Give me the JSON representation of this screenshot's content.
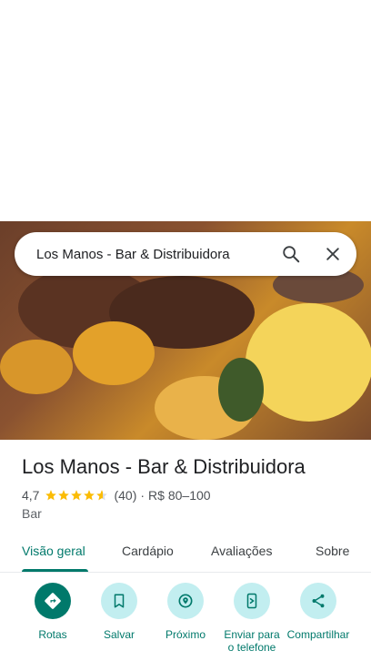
{
  "search": {
    "query": "Los Manos - Bar & Distribuidora"
  },
  "place": {
    "name": "Los Manos - Bar & Distribuidora",
    "rating": "4,7",
    "rating_value": 4.7,
    "review_count": "(40)",
    "separator": "·",
    "price_range": "R$ 80–100",
    "category": "Bar"
  },
  "tabs": [
    {
      "label": "Visão geral"
    },
    {
      "label": "Cardápio"
    },
    {
      "label": "Avaliações"
    },
    {
      "label": "Sobre"
    }
  ],
  "actions": [
    {
      "label": "Rotas",
      "icon": "directions-icon"
    },
    {
      "label": "Salvar",
      "icon": "bookmark-icon"
    },
    {
      "label": "Próximo",
      "icon": "nearby-icon"
    },
    {
      "label": "Enviar para o telefone",
      "icon": "send-to-phone-icon"
    },
    {
      "label": "Compartilhar",
      "icon": "share-icon"
    }
  ],
  "colors": {
    "accent": "#00796b",
    "action_bg": "#c2eef0",
    "star": "#fbbc04"
  }
}
